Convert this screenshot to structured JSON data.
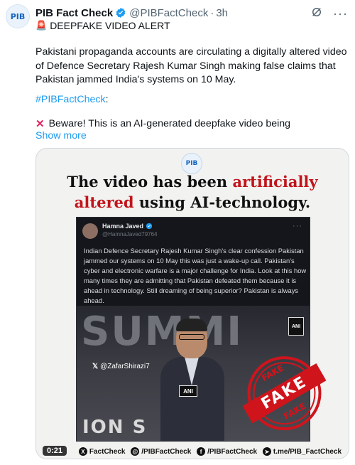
{
  "post": {
    "avatar_text": "PIB",
    "author_name": "PIB Fact Check",
    "handle": "@PIBFactCheck",
    "separator": "·",
    "time": "3h",
    "alert_line": "DEEPFAKE VIDEO ALERT",
    "body": "Pakistani propaganda accounts are circulating a digitally altered video of Defence Secretary Rajesh Kumar Singh making false claims that Pakistan jammed India's systems on 10 May.",
    "hashtag": "#PIBFactCheck",
    "hashtag_suffix": ":",
    "beware": "Beware! This is an AI-generated deepfake video being",
    "show_more": "Show more"
  },
  "icons": {
    "verified": "verified-badge-icon",
    "grok": "grok-icon",
    "more": "more-icon",
    "siren": "siren-icon",
    "cross": "cross-mark-icon"
  },
  "colors": {
    "link": "#1d9bf0",
    "verified": "#1d9bf0",
    "alert_red": "#c2141b",
    "stamp_red": "#d0141c"
  },
  "media": {
    "logo_text": "PIB",
    "headline_part1": "The video has been ",
    "headline_red1": "artificially",
    "headline_red2": "altered",
    "headline_part2": " using AI-technology.",
    "embedded_post": {
      "name": "Hamna Javed",
      "handle": "@HamnaJaved79764",
      "text": "Indian Defence Secretary Rajesh Kumar Singh's clear confession Pakistan jammed our systems on 10 May  this was just a wake-up call. Pakistan's cyber and electronic warfare is a major challenge for India. Look  at  this  how many times they are admitting that Pakistan defeated them because it is ahead in technology.  Still dreaming of being superior? Pakistan is always ahead."
    },
    "stage_bg_text": "SUMMI",
    "stage_bottom_text": "ION S",
    "watermark": "@ZafarShirazi7",
    "ani_label": "ANI",
    "stamp": {
      "top": "FAKE",
      "center": "FAKE",
      "bottom": "FAKE"
    },
    "footer": [
      {
        "icon": "x-icon",
        "glyph": "X",
        "label": "FactCheck"
      },
      {
        "icon": "threads-icon",
        "glyph": "@",
        "label": "/PIBFactCheck"
      },
      {
        "icon": "facebook-icon",
        "glyph": "f",
        "label": "/PIBFactCheck"
      },
      {
        "icon": "telegram-icon",
        "glyph": "➤",
        "label": "t.me/PIB_FactCheck"
      }
    ],
    "video_time": "0:21"
  }
}
